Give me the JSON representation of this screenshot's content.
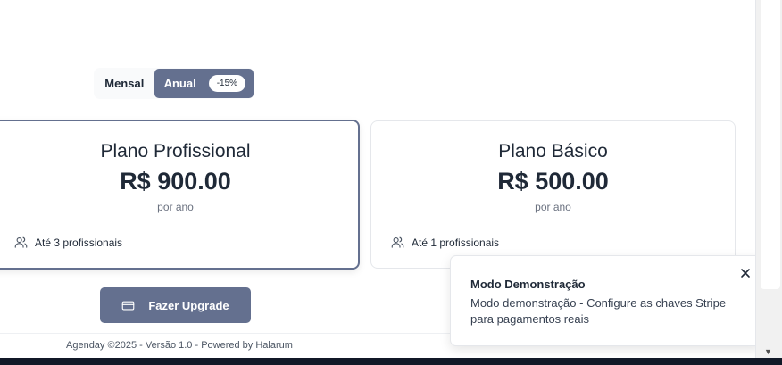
{
  "billing_toggle": {
    "monthly_label": "Mensal",
    "annual_label": "Anual",
    "discount_badge": "-15%",
    "selected": "annual"
  },
  "plans": [
    {
      "title": "Plano Profissional",
      "price": "R$ 900.00",
      "period": "por ano",
      "feature_icon": "users-icon",
      "feature": "Até 3 profissionais",
      "selected": true
    },
    {
      "title": "Plano Básico",
      "price": "R$ 500.00",
      "period": "por ano",
      "feature_icon": "users-icon",
      "feature": "Até 1 profissionais",
      "selected": false
    }
  ],
  "upgrade_button": {
    "icon": "credit-card-icon",
    "label": "Fazer Upgrade"
  },
  "footer": {
    "text": "Agenday ©2025 - Versão 1.0 - Powered by Halarum"
  },
  "toast": {
    "title": "Modo Demonstração",
    "message": "Modo demonstração - Configure as chaves Stripe para pagamentos reais",
    "close_icon": "close-icon"
  },
  "colors": {
    "accent": "#64708f",
    "text": "#1f2937",
    "muted": "#6b7280",
    "border": "#e5e7eb"
  }
}
